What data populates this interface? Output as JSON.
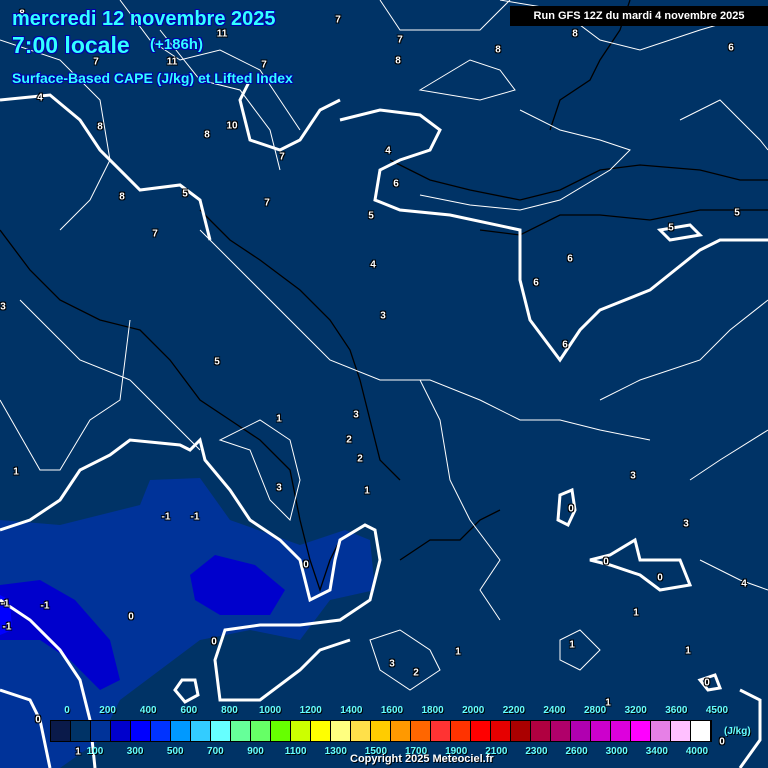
{
  "header": {
    "date": "mercredi 12 novembre 2025",
    "time": "7:00 locale",
    "lead": "(+186h)",
    "parameter": "Surface-Based CAPE (J/kg) et Lifted Index",
    "run": "Run GFS 12Z du mardi 4 novembre 2025"
  },
  "colors": {
    "background": "#003366",
    "cape_100": "#003399",
    "cape_300": "#0000cc",
    "title": "#33ffff"
  },
  "map": {
    "labels": [
      "8",
      "7",
      "11",
      "7",
      "8",
      "8",
      "8",
      "6",
      "7",
      "11",
      "7",
      "4",
      "8",
      "10",
      "8",
      "7",
      "4",
      "6",
      "5",
      "8",
      "7",
      "7",
      "5",
      "5",
      "5",
      "6",
      "4",
      "6",
      "3",
      "3",
      "6",
      "5",
      "3",
      "1",
      "2",
      "2",
      "1",
      "3",
      "3",
      "1",
      "-1",
      "-1",
      "0",
      "3",
      "0",
      "0",
      "0",
      "4",
      "-1",
      "-1",
      "-1",
      "0",
      "1",
      "0",
      "1",
      "1",
      "1",
      "3",
      "2",
      "0",
      "1",
      "0",
      "0",
      "1"
    ]
  },
  "legend": {
    "colors": [
      "#0a1a4a",
      "#003366",
      "#003399",
      "#0000cc",
      "#0000ff",
      "#0033ff",
      "#0099ff",
      "#33ccff",
      "#66ffff",
      "#66ff99",
      "#66ff66",
      "#66ff00",
      "#ccff00",
      "#ffff00",
      "#ffff80",
      "#ffe04a",
      "#ffcc00",
      "#ff9900",
      "#ff6600",
      "#ff3333",
      "#ff3300",
      "#ff0000",
      "#e60000",
      "#aa0000",
      "#b00040",
      "#b0006a",
      "#b000b0",
      "#cc00cc",
      "#dd00dd",
      "#ff00ff",
      "#e680e6",
      "#ffc0ff",
      "#ffffff"
    ],
    "top_labels": [
      "0",
      "200",
      "400",
      "600",
      "800",
      "1000",
      "1200",
      "1400",
      "1600",
      "1800",
      "2000",
      "2200",
      "2400",
      "2800",
      "3200",
      "3600",
      "4500"
    ],
    "bottom_labels": [
      "100",
      "300",
      "500",
      "700",
      "900",
      "1100",
      "1300",
      "1500",
      "1700",
      "1900",
      "2100",
      "2300",
      "2600",
      "3000",
      "3400",
      "4000"
    ],
    "unit": "(J/kg)"
  },
  "footer": {
    "copyright": "Copyright 2025 Meteociel.fr"
  }
}
